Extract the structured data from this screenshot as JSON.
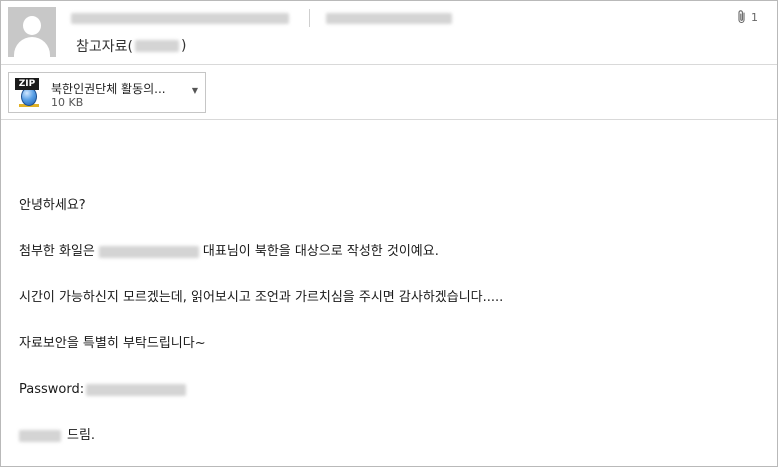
{
  "header": {
    "subject_prefix": "참고자료(",
    "subject_suffix": ")",
    "attachment_count": "1",
    "icons": {
      "avatar": "person-placeholder-icon",
      "attachment": "paperclip-icon"
    }
  },
  "attachment": {
    "type_label": "ZIP",
    "name": "북한인권단체 활동의...",
    "size": "10 KB",
    "dropdown_icon": "chevron-down-icon"
  },
  "body": {
    "greeting": "안녕하세요?",
    "line1_prefix": "첨부한 화일은",
    "line1_suffix": "대표님이 북한을 대상으로 작성한 것이예요.",
    "line2": "시간이 가능하신지 모르겠는데, 읽어보시고 조언과 가르치심을 주시면 감사하겠습니다.....",
    "line3": "자료보안을 특별히 부탁드립니다~",
    "password_label": "Password:",
    "closing_suffix": "드림."
  },
  "colors": {
    "border": "#b9b9b9",
    "avatar_bg": "#c8c8c8",
    "redaction": "#d4d4d4"
  }
}
